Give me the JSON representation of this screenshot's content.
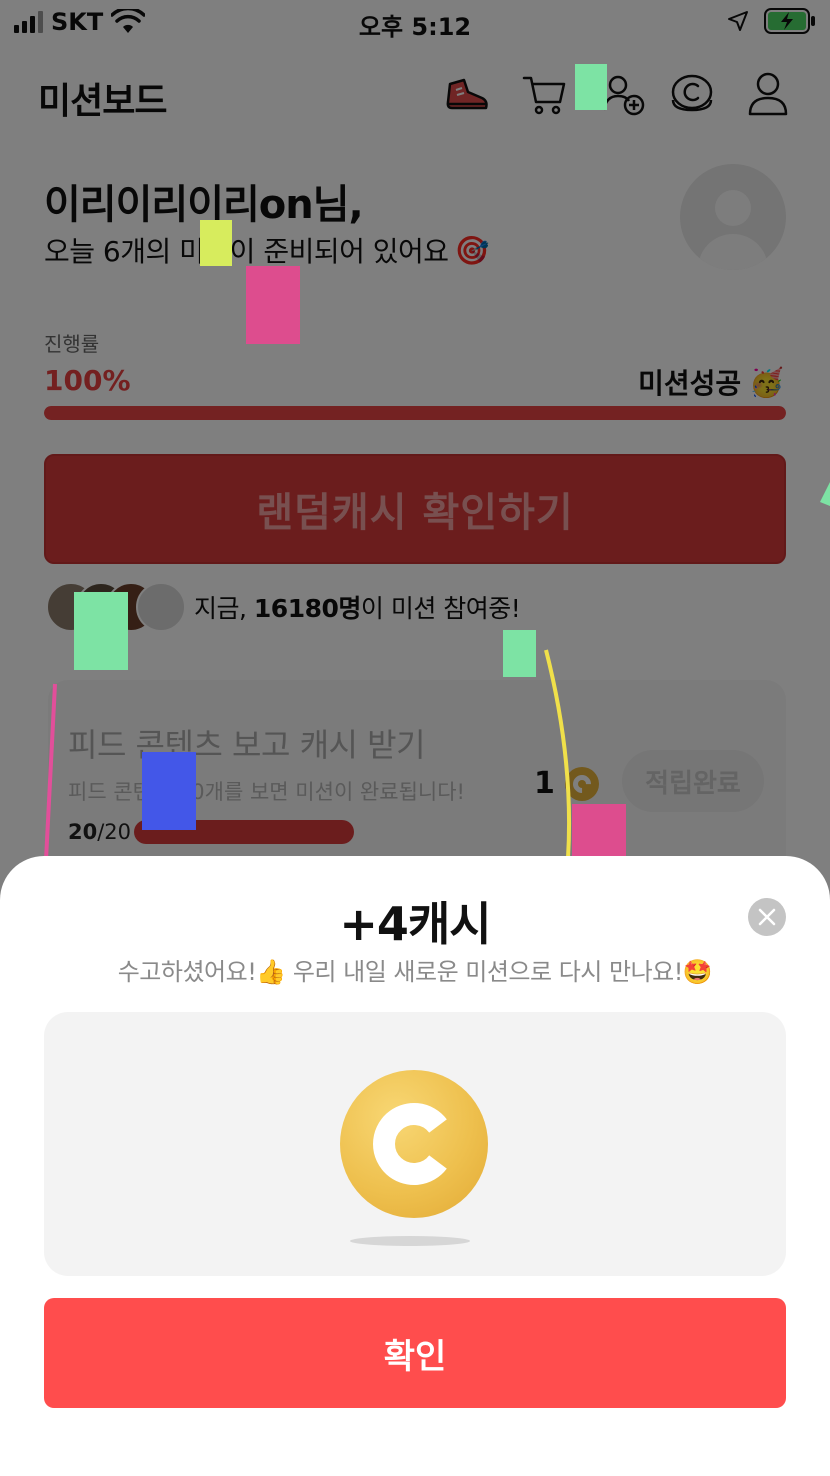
{
  "status_bar": {
    "carrier": "SKT",
    "time": "오후 5:12"
  },
  "header": {
    "title": "미션보드",
    "icons": [
      "sneaker-icon",
      "cart-icon",
      "add-friend-icon",
      "cash-icon",
      "profile-icon"
    ]
  },
  "greeting": {
    "name": "이리이리이리on님,",
    "subtitle": "오늘 6개의 미션이 준비되어 있어요",
    "subtitle_emoji": "🎯"
  },
  "progress": {
    "label": "진행률",
    "value_text": "100%",
    "fraction": 1.0,
    "status": "미션성공",
    "status_emoji": "🥳"
  },
  "random_cash_button": {
    "label": "랜덤캐시 확인하기"
  },
  "participants": {
    "prefix": "지금, ",
    "count": "16180명",
    "suffix": "이 미션 참여중!"
  },
  "mission_card": {
    "title": "피드 콘텐츠 보고 캐시 받기",
    "description": "피드 콘텐츠 20개를 보면 미션이 완료됩니다!",
    "count_done": "20",
    "count_total": "/20",
    "reward": "1",
    "status_button": "적립완료"
  },
  "reward_sheet": {
    "title": "+4캐시",
    "message": "수고하셨어요!👍 우리 내일 새로운 미션으로 다시 만나요!🤩",
    "confirm_label": "확인"
  },
  "colors": {
    "accent": "#ff4d4d",
    "progress": "#e84545",
    "coin": "#eec04e"
  }
}
